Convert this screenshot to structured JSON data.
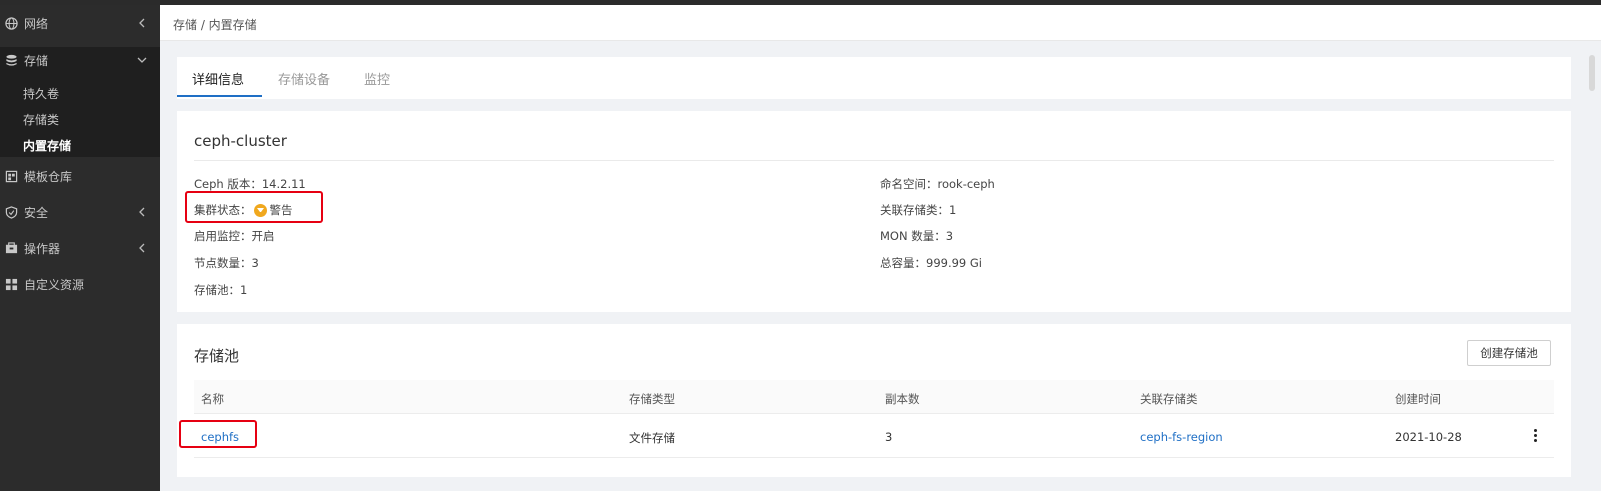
{
  "sidebar": {
    "items": [
      {
        "label": "网络",
        "icon": "globe-icon"
      },
      {
        "label": "存储",
        "icon": "database-icon"
      },
      {
        "label": "模板仓库",
        "icon": "template-icon"
      },
      {
        "label": "安全",
        "icon": "shield-icon"
      },
      {
        "label": "操作器",
        "icon": "operator-icon"
      },
      {
        "label": "自定义资源",
        "icon": "grid-icon"
      }
    ],
    "storage_sub_items": [
      {
        "label": "持久卷"
      },
      {
        "label": "存储类"
      },
      {
        "label": "内置存储",
        "active": true
      }
    ]
  },
  "breadcrumb": "存储 / 内置存储",
  "tabs": [
    {
      "label": "详细信息",
      "active": true
    },
    {
      "label": "存储设备"
    },
    {
      "label": "监控"
    }
  ],
  "cluster": {
    "name": "ceph-cluster",
    "left_fields": {
      "version_label": "Ceph 版本：",
      "version_value": "14.2.11",
      "status_label": "集群状态：",
      "status_value": "警告",
      "monitor_label": "启用监控：",
      "monitor_value": "开启",
      "nodes_label": "节点数量：",
      "nodes_value": "3",
      "pools_label": "存储池：",
      "pools_value": "1"
    },
    "right_fields": {
      "namespace_label": "命名空间：",
      "namespace_value": "rook-ceph",
      "storageclass_label": "关联存储类：",
      "storageclass_value": "1",
      "mon_label": "MON 数量：",
      "mon_value": "3",
      "capacity_label": "总容量：",
      "capacity_value": "999.99 Gi"
    },
    "status_color": "#f0a81e"
  },
  "pool_section": {
    "title": "存储池",
    "create_button": "创建存储池",
    "columns": [
      "名称",
      "存储类型",
      "副本数",
      "关联存储类",
      "创建时间"
    ],
    "rows": [
      {
        "name": "cephfs",
        "type": "文件存储",
        "replicas": "3",
        "storage_class": "ceph-fs-region",
        "created": "2021-10-28"
      }
    ]
  },
  "colors": {
    "accent": "#1f6fc5",
    "highlight": "#e60012",
    "sidebar_bg": "#2c2c2c"
  }
}
